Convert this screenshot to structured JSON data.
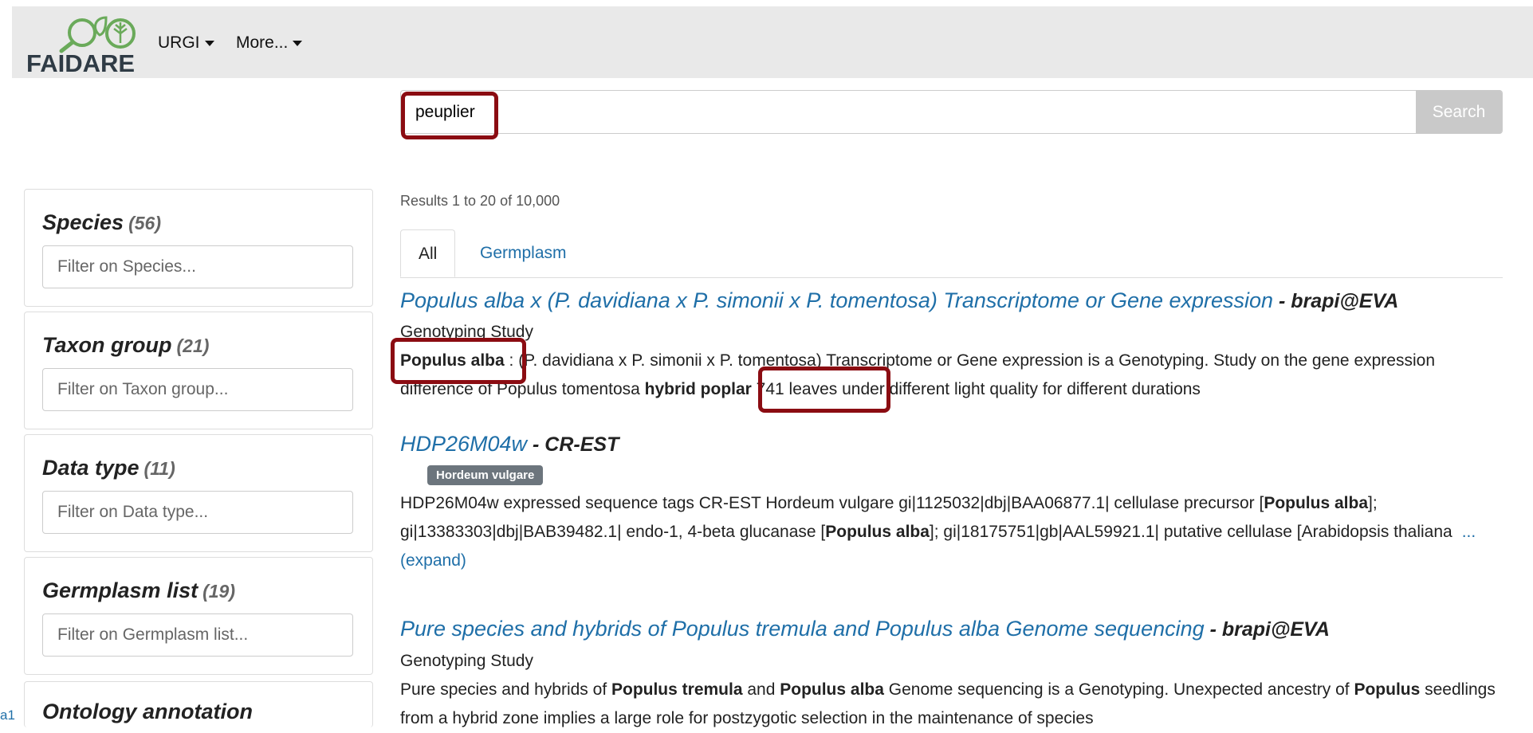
{
  "navbar": {
    "logo_text": "FAIDARE",
    "menu": [
      {
        "label": "URGI"
      },
      {
        "label": "More..."
      }
    ]
  },
  "search": {
    "value": "peuplier",
    "button_label": "Search"
  },
  "facets": [
    {
      "title": "Species",
      "count": "(56)",
      "placeholder": "Filter on Species..."
    },
    {
      "title": "Taxon group",
      "count": "(21)",
      "placeholder": "Filter on Taxon group..."
    },
    {
      "title": "Data type",
      "count": "(11)",
      "placeholder": "Filter on Data type..."
    },
    {
      "title": "Germplasm list",
      "count": "(19)",
      "placeholder": "Filter on Germplasm list..."
    },
    {
      "title": "Ontology annotation",
      "count": ""
    }
  ],
  "results_summary": "Results 1 to 20 of 10,000",
  "tabs": [
    {
      "label": "All",
      "active": true
    },
    {
      "label": "Germplasm",
      "active": false
    }
  ],
  "results": [
    {
      "title": "Populus alba x (P. davidiana x P. simonii x P. tomentosa) Transcriptome or Gene expression",
      "source": " - brapi@EVA",
      "type": "Genotyping Study",
      "desc": [
        {
          "t": "Populus alba",
          "b": true
        },
        {
          "t": " : (P. davidiana x P. simonii x P. tomentosa) Transcriptome or Gene expression is a Genotyping. Study on the gene expression difference of Populus tomentosa ",
          "b": false
        },
        {
          "t": "hybrid poplar",
          "b": true
        },
        {
          "t": " 741 leaves under different light quality for different durations",
          "b": false
        }
      ]
    },
    {
      "title": "HDP26M04w",
      "source": " - CR-EST",
      "badge": "Hordeum vulgare",
      "desc": [
        {
          "t": "HDP26M04w expressed sequence tags CR-EST Hordeum vulgare gi|1125032|dbj|BAA06877.1| cellulase precursor [",
          "b": false
        },
        {
          "t": "Populus alba",
          "b": true
        },
        {
          "t": "]; gi|13383303|dbj|BAB39482.1| endo-1, 4-beta glucanase [",
          "b": false
        },
        {
          "t": "Populus alba",
          "b": true
        },
        {
          "t": "]; gi|18175751|gb|AAL59921.1| putative cellulase [Arabidopsis thaliana",
          "b": false
        }
      ],
      "expand_label": "... (expand)"
    },
    {
      "title": "Pure species and hybrids of Populus tremula and Populus alba Genome sequencing",
      "source": " - brapi@EVA",
      "type": "Genotyping Study",
      "desc": [
        {
          "t": "Pure species and hybrids of ",
          "b": false
        },
        {
          "t": "Populus tremula",
          "b": true
        },
        {
          "t": " and ",
          "b": false
        },
        {
          "t": "Populus alba",
          "b": true
        },
        {
          "t": " Genome sequencing is a Genotyping. Unexpected ancestry of ",
          "b": false
        },
        {
          "t": "Populus",
          "b": true
        },
        {
          "t": " seedlings from a hybrid zone implies a large role for postzygotic selection in the maintenance of species",
          "b": false
        }
      ]
    }
  ],
  "side_fragment": "a1"
}
